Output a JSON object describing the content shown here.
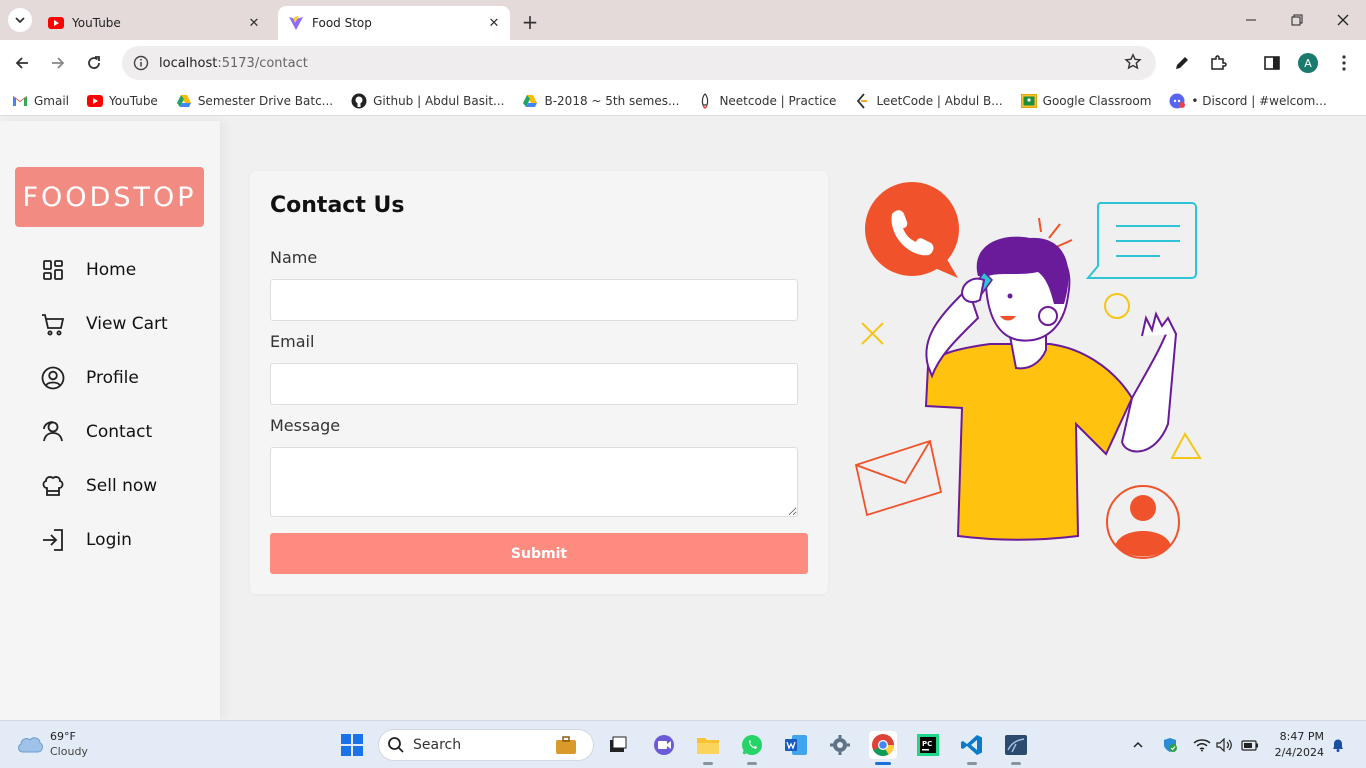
{
  "browser": {
    "tabs": [
      {
        "title": "YouTube",
        "active": false,
        "icon": "youtube-icon"
      },
      {
        "title": "Food Stop",
        "active": true,
        "icon": "vite-icon"
      }
    ],
    "url_host": "localhost",
    "url_path": ":5173/contact",
    "profile_initial": "A",
    "bookmarks": [
      {
        "label": "Gmail",
        "icon": "gmail-icon"
      },
      {
        "label": "YouTube",
        "icon": "youtube-icon"
      },
      {
        "label": "Semester Drive Batc...",
        "icon": "drive-icon"
      },
      {
        "label": "Github | Abdul Basit...",
        "icon": "github-icon"
      },
      {
        "label": "B-2018 ~ 5th semes...",
        "icon": "drive-icon"
      },
      {
        "label": "Neetcode | Practice",
        "icon": "rocket-icon"
      },
      {
        "label": "LeetCode | Abdul B...",
        "icon": "leetcode-icon"
      },
      {
        "label": "Google Classroom",
        "icon": "classroom-icon"
      },
      {
        "label": "• Discord | #welcom...",
        "icon": "discord-icon"
      }
    ]
  },
  "app": {
    "logo": "FOODSTOP",
    "menu": [
      {
        "label": "Home",
        "icon": "dashboard-icon"
      },
      {
        "label": "View Cart",
        "icon": "cart-icon"
      },
      {
        "label": "Profile",
        "icon": "user-circle-icon"
      },
      {
        "label": "Contact",
        "icon": "contact-icon"
      },
      {
        "label": "Sell now",
        "icon": "chef-hat-icon"
      },
      {
        "label": "Login",
        "icon": "login-icon"
      }
    ],
    "contact": {
      "title": "Contact Us",
      "name_label": "Name",
      "name_value": "",
      "email_label": "Email",
      "email_value": "",
      "message_label": "Message",
      "message_value": "",
      "submit_label": "Submit"
    },
    "colors": {
      "brand": "#f28b82",
      "submit": "#fd8b7f"
    }
  },
  "taskbar": {
    "weather_temp": "69°F",
    "weather_desc": "Cloudy",
    "search_label": "Search",
    "time": "8:47 PM",
    "date": "2/4/2024"
  }
}
